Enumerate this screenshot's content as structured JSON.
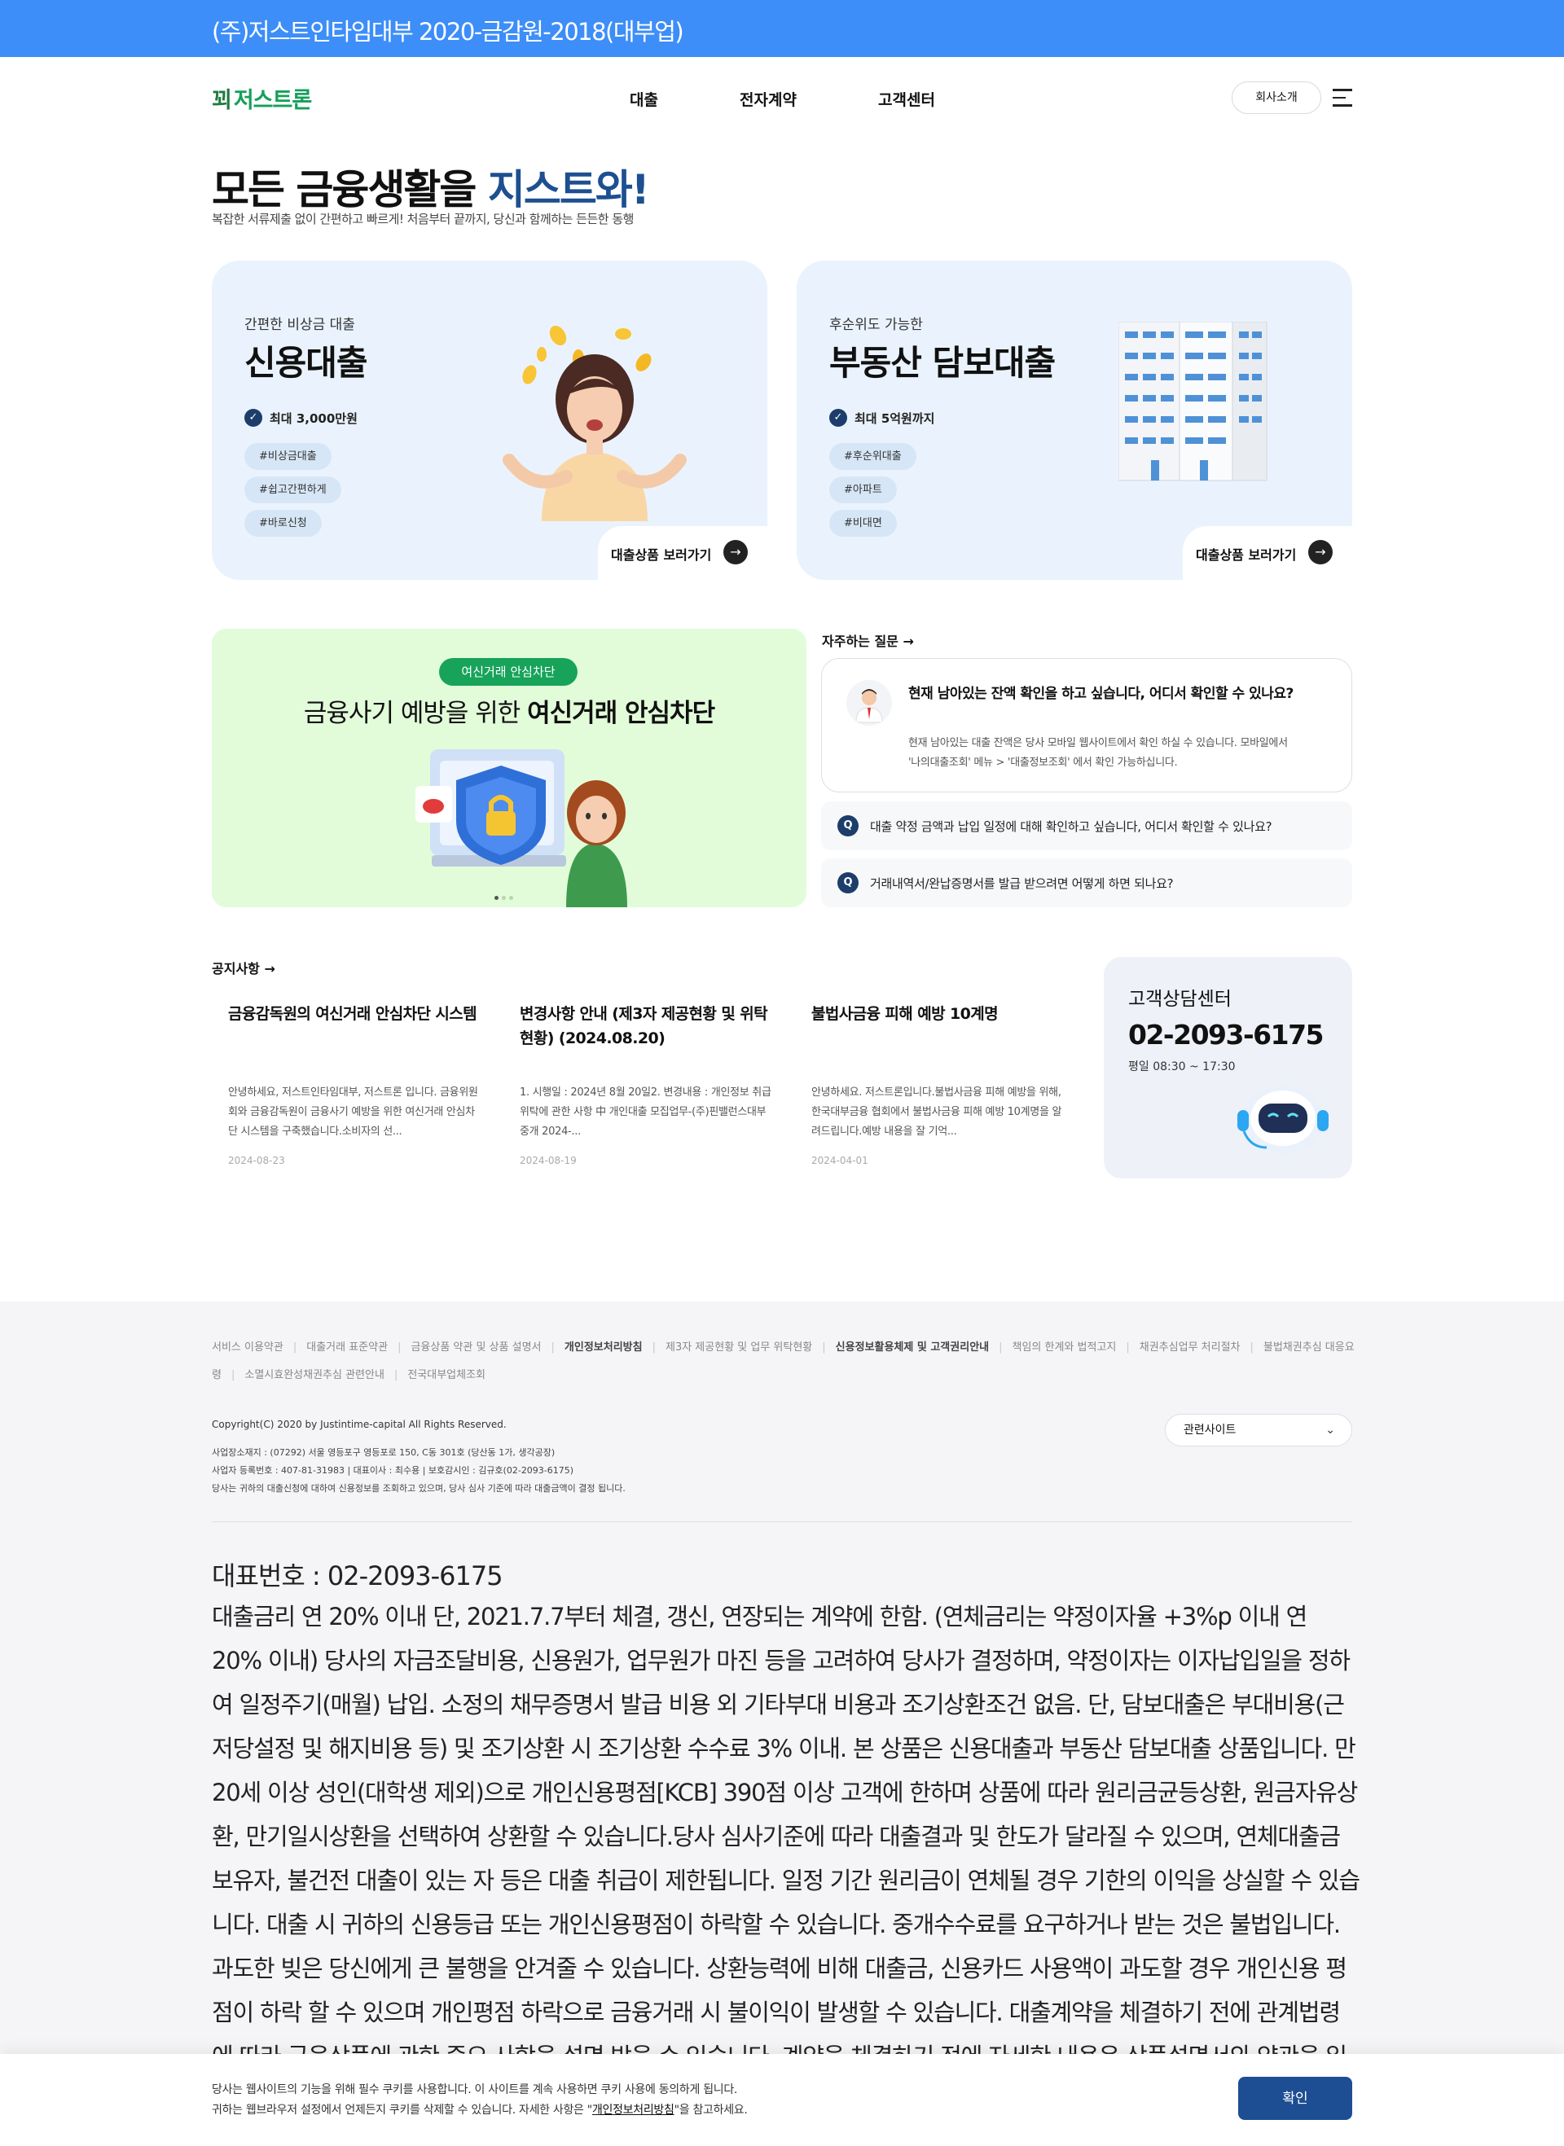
{
  "topbar": {
    "text": "(주)저스트인타임대부 2020-금감원-2018(대부업)"
  },
  "header": {
    "logo": "저스트론",
    "nav": [
      "대출",
      "전자계약",
      "고객센터"
    ],
    "about_button": "회사소개"
  },
  "hero": {
    "title_main": "모든 금융생활을 ",
    "title_highlight": "지스트와!",
    "subtitle": "복잡한 서류제출 없이 간편하고 빠르게! 처음부터 끝까지, 당신과 함께하는 든든한 동행"
  },
  "cards": [
    {
      "small": "간편한 비상금 대출",
      "title": "신용대출",
      "max": "최대 3,000만원",
      "tags": [
        "#비상금대출",
        "#쉽고간편하게",
        "#바로신청"
      ],
      "link": "대출상품 보러가기"
    },
    {
      "small": "후순위도 가능한",
      "title": "부동산 담보대출",
      "max": "최대 5억원까지",
      "tags": [
        "#후순위대출",
        "#아파트",
        "#비대면"
      ],
      "link": "대출상품 보러가기"
    }
  ],
  "banner": {
    "pill": "여신거래 안심차단",
    "title_pre": "금융사기 예방을 위한 ",
    "title_bold": "여신거래 안심차단"
  },
  "faq": {
    "heading": "자주하는 질문",
    "featured_q": "현재 남아있는 잔액 확인을 하고 싶습니다, 어디서 확인할 수 있나요?",
    "featured_a1": "현재 남아있는 대출 잔액은 당사 모바일 웹사이트에서 확인 하실 수 있습니다. 모바일에서",
    "featured_a2": "'나의대출조회' 메뉴 > '대출정보조회' 에서 확인 가능하십니다.",
    "items": [
      "대출 약정 금액과 납입 일정에 대해 확인하고 싶습니다, 어디서 확인할 수 있나요?",
      "거래내역서/완납증명서를 발급 받으려면 어떻게 하면 되나요?"
    ],
    "q_mark": "Q"
  },
  "notices": {
    "heading": "공지사항",
    "items": [
      {
        "title": "금융감독원의 여신거래 안심차단 시스템",
        "body": "안녕하세요, 저스트인타임대부, 저스트론 입니다. 금융위원회와 금융감독원이 금융사기 예방을 위한 여신거래 안심차단 시스템을 구축했습니다.소비자의 선...",
        "date": "2024-08-23"
      },
      {
        "title": "변경사항 안내 (제3자 제공현황 및 위탁현황) (2024.08.20)",
        "body": "1. 시행일 : 2024년 8월 20일2. 변경내용 : 개인정보 취급 위탁에 관한 사항 中 개인대출 모집업무-(주)핀밸런스대부중개 2024-...",
        "date": "2024-08-19"
      },
      {
        "title": "불법사금융 피해 예방 10계명",
        "body": "안녕하세요. 저스트론입니다.불법사금융 피해 예방을 위해, 한국대부금융 협회에서 불법사금융 피해 예방 10계명을 알려드립니다.예방 내용을 잘 기억...",
        "date": "2024-04-01"
      }
    ]
  },
  "customer_center": {
    "title": "고객상담센터",
    "phone": "02-2093-6175",
    "hours": "평일 08:30 ~ 17:30"
  },
  "footer": {
    "links": [
      {
        "label": "서비스 이용약관",
        "strong": false
      },
      {
        "label": "대출거래 표준약관",
        "strong": false
      },
      {
        "label": "금융상품 약관 및 상품 설명서",
        "strong": false
      },
      {
        "label": "개인정보처리방침",
        "strong": true
      },
      {
        "label": "제3자 제공현황 및 업무 위탁현황",
        "strong": false
      },
      {
        "label": "신용정보활용체제 및 고객권리안내",
        "strong": true
      },
      {
        "label": "책임의 한계와 법적고지",
        "strong": false
      },
      {
        "label": "채권추심업무 처리절차",
        "strong": false
      },
      {
        "label": "불법채권추심 대응요령",
        "strong": false
      },
      {
        "label": "소멸시효완성채권추심 관련안내",
        "strong": false
      },
      {
        "label": "전국대부업체조회",
        "strong": false
      }
    ],
    "copyright": "Copyright(C) 2020 by Justintime-capital All Rights Reserved.",
    "info1": "사업장소재지 : (07292) 서울 영등포구 영등포로 150, C동 301호 (당산동 1가, 생각공장)",
    "info2": "사업자 등록번호 : 407-81-31983 | 대표이사 : 최수용 | 보호감시인 : 김규호(02-2093-6175)",
    "info3": "당사는 귀하의 대출신청에 대하여 신용정보를 조회하고 있으며, 당사 심사 기준에 따라 대출금액이 결정 됩니다.",
    "related": "관련사이트",
    "rep_number": "대표번호 : 02-2093-6175",
    "legal": "대출금리 연 20% 이내 단, 2021.7.7부터 체결, 갱신, 연장되는 계약에 한함. (연체금리는 약정이자율 +3%p 이내 연 20% 이내)  당사의 자금조달비용, 신용원가, 업무원가 마진 등을 고려하여 당사가 결정하며, 약정이자는 이자납입일을 정하여 일정주기(매월) 납입.  소정의 채무증명서 발급 비용 외 기타부대 비용과 조기상환조건 없음. 단, 담보대출은 부대비용(근저당설정 및 해지비용 등) 및 조기상환 시 조기상환 수수료 3% 이내.  본 상품은 신용대출과 부동산 담보대출 상품입니다. 만 20세 이상 성인(대학생 제외)으로 개인신용평점[KCB] 390점 이상 고객에 한하며 상품에 따라 원리금균등상환, 원금자유상환, 만기일시상환을 선택하여 상환할 수 있습니다.당사 심사기준에 따라 대출결과 및 한도가 달라질 수 있으며, 연체대출금 보유자, 불건전 대출이 있는 자 등은 대출 취급이 제한됩니다.  일정 기간 원리금이 연체될 경우 기한의 이익을 상실할 수 있습니다.  대출 시 귀하의 신용등급 또는 개인신용평점이 하락할 수 있습니다. 중개수수료를 요구하거나 받는 것은 불법입니다. 과도한 빚은 당신에게 큰 불행을 안겨줄 수 있습니다.  상환능력에 비해 대출금, 신용카드 사용액이 과도할 경우 개인신용 평점이 하락 할 수 있으며 개인평점 하락으로 금융거래 시 불이익이 발생할 수 있습니다. 대출계약을 체결하기 전에 관계법령에 따라 금융상품에 관한 중요 사항을 설명 받을 수 있습니다. 계약을 체결하기 전에 자세한 내용은 상품설명서와 약관을 읽어보시기 바랍니다."
  },
  "cookie": {
    "line1": "당사는 웹사이트의 기능을 위해 필수 쿠키를 사용합니다. 이 사이트를 계속 사용하면 쿠키 사용에 동의하게 됩니다.",
    "line2_pre": "귀하는 웹브라우저 설정에서 언제든지 쿠키를 삭제할 수 있습니다. 자세한 사항은 \"",
    "line2_link": "개인정보처리방침",
    "line2_post": "\"을 참고하세요.",
    "button": "확인"
  }
}
